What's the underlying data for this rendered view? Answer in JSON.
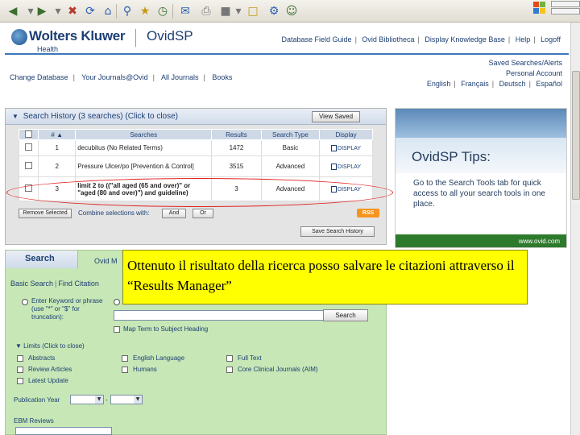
{
  "browser": {
    "icons": [
      "back-icon",
      "forward-icon",
      "stop-icon",
      "refresh-icon",
      "home-icon",
      "search-icon",
      "favorites-icon",
      "history-icon",
      "mail-icon",
      "print-icon",
      "edit-icon",
      "folder-icon",
      "tools-icon",
      "messenger-icon"
    ]
  },
  "header": {
    "brand": "Wolters Kluwer",
    "brand_sub": "Health",
    "product": "OvidSP",
    "top_links": [
      "Database Field Guide",
      "Ovid Bibliotheca",
      "Display Knowledge Base",
      "Help",
      "Logoff"
    ]
  },
  "nav2": {
    "links": [
      "Change Database",
      "Your Journals@Ovid",
      "All Journals",
      "Books"
    ]
  },
  "account": {
    "saved": "Saved Searches/Alerts",
    "personal": "Personal Account",
    "languages": [
      "English",
      "Français",
      "Deutsch",
      "Español"
    ]
  },
  "history": {
    "title": "Search History",
    "count_note": "(3 searches)",
    "toggle_note": "(Click to close)",
    "view_saved": "View Saved",
    "columns": [
      "#",
      "Searches",
      "Results",
      "Search Type",
      "Display"
    ],
    "rows": [
      {
        "num": "1",
        "query": "decubitus (No Related Terms)",
        "results": "1472",
        "type": "Basic",
        "display": "DISPLAY"
      },
      {
        "num": "2",
        "query": "Pressure Ulcer/po [Prevention & Control]",
        "results": "3515",
        "type": "Advanced",
        "display": "DISPLAY"
      },
      {
        "num": "3",
        "query": "limit 2 to ((\"all aged (65 and over)\" or \"aged (80 and over)\") and guideline)",
        "results": "3",
        "type": "Advanced",
        "display": "DISPLAY"
      }
    ],
    "remove_selected": "Remove Selected",
    "combine_label": "Combine selections with:",
    "and": "And",
    "or": "Or",
    "rss": "RSS",
    "save_history": "Save Search History"
  },
  "tips": {
    "title": "OvidSP Tips:",
    "text": "Go to the Search Tools tab for quick access to all your search tools in one place.",
    "url": "www.ovid.com"
  },
  "search": {
    "tab": "Search",
    "ovid_tab": "Ovid M",
    "subtabs": [
      "Basic Search",
      "Find Citation"
    ],
    "keyword_label": "Enter Keyword or phrase (use \"*\" or \"$\" for truncation):",
    "search_button": "Search",
    "map_label": "Map Term to Subject Heading",
    "limits_label": "Limits",
    "limits_toggle": "(Click to close)",
    "limits": [
      "Abstracts",
      "Review Articles",
      "Latest Update",
      "English Language",
      "Humans",
      "Full Text",
      "Core Clinical Journals (AIM)"
    ],
    "pub_year": "Publication Year",
    "ebm": "EBM Reviews"
  },
  "caption": {
    "text": "Ottenuto il risultato della ricerca posso salvare le citazioni attraverso il “Results Manager”"
  },
  "colors": {
    "brand_blue": "#1d3f74",
    "panel_green": "#c7e7b6",
    "callout_yellow": "#ffff00",
    "highlight_red": "#e0201e",
    "footer_green": "#2e7a2c"
  }
}
